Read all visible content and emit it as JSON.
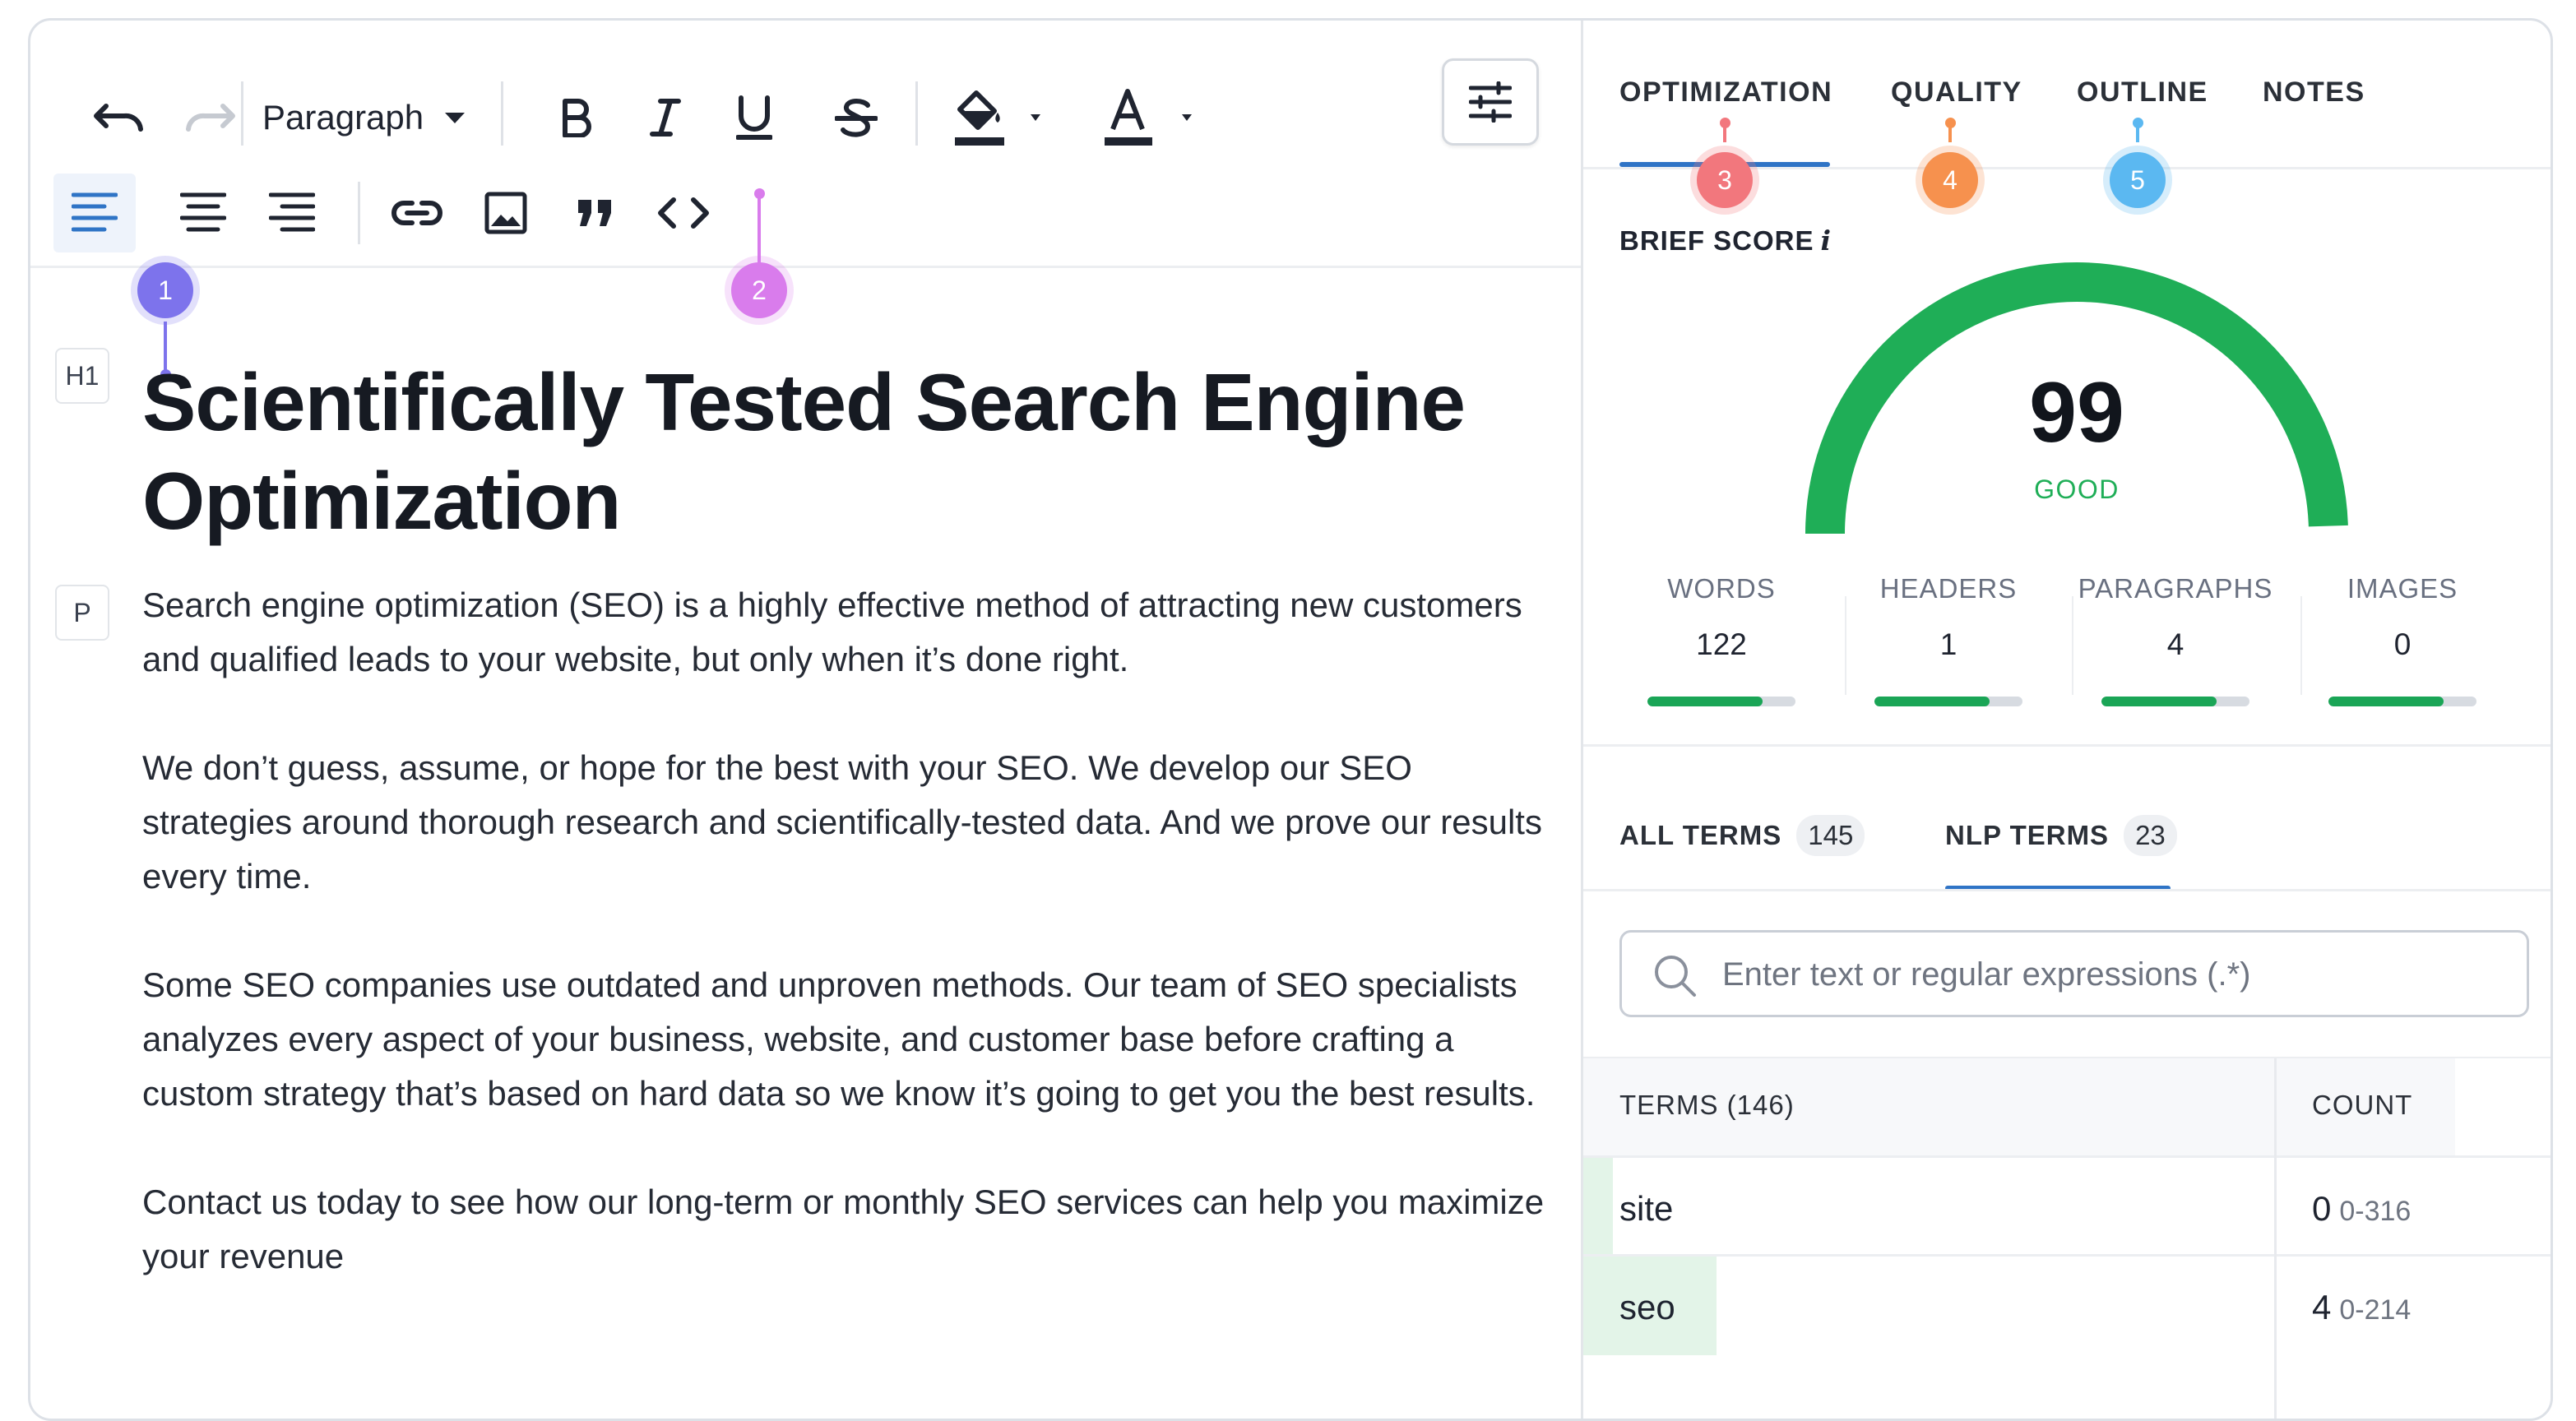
{
  "editor": {
    "toolbar": {
      "block_type": "Paragraph"
    },
    "markers": [
      "1",
      "2"
    ],
    "blocks": [
      {
        "tag": "H1",
        "text": "Scientifically Tested Search Engine Optimization"
      },
      {
        "tag": "P",
        "text": "Search engine optimization (SEO) is a highly effective method of attracting new customers and qualified leads to your website, but only when it’s done right."
      }
    ],
    "paragraphs": [
      "We don’t guess, assume, or hope for the best with your SEO. We develop our SEO strategies around thorough research and scientifically-tested data. And we prove our results every time.",
      "Some SEO companies use outdated and unproven methods. Our team of SEO specialists analyzes every aspect of your business, website, and customer base before crafting a custom strategy that’s based on hard data so we know it’s going to get you the best results.",
      "Contact us today to see how our long-term or monthly SEO services can help you maximize your revenue"
    ]
  },
  "panel": {
    "tabs": [
      {
        "label": "OPTIMIZATION",
        "marker": "3",
        "active": true
      },
      {
        "label": "QUALITY",
        "marker": "4"
      },
      {
        "label": "OUTLINE",
        "marker": "5"
      },
      {
        "label": "NOTES"
      }
    ],
    "brief_score": {
      "label": "BRIEF SCORE",
      "info": "i",
      "value": "99",
      "max": 100,
      "rating": "GOOD"
    },
    "stats": [
      {
        "label": "WORDS",
        "value": "122",
        "progress": 0.78
      },
      {
        "label": "HEADERS",
        "value": "1",
        "progress": 0.78
      },
      {
        "label": "PARAGRAPHS",
        "value": "4",
        "progress": 0.78
      },
      {
        "label": "IMAGES",
        "value": "0",
        "progress": 0.78
      }
    ],
    "term_tabs": [
      {
        "label": "ALL TERMS",
        "count": "145"
      },
      {
        "label": "NLP TERMS",
        "count": "23",
        "active": true
      }
    ],
    "search": {
      "placeholder": "Enter text or regular expressions (.*)",
      "value": ""
    },
    "table": {
      "headers": [
        "TERMS (146)",
        "COUNT"
      ],
      "rows": [
        {
          "term": "site",
          "count": "0",
          "range": "0-316",
          "coverage": 0.0
        },
        {
          "term": "seo",
          "count": "4",
          "range": "0-214",
          "coverage": 0.02
        }
      ]
    }
  },
  "colors": {
    "accent": "#2f74c6",
    "good": "#1fae57",
    "marker_1": "#7d73ec",
    "marker_2": "#d97cec",
    "marker_3": "#f2777d",
    "marker_4": "#f6914e",
    "marker_5": "#5bb8f1"
  },
  "icons": [
    "undo-icon",
    "redo-icon",
    "bold-icon",
    "italic-icon",
    "underline-icon",
    "strikethrough-icon",
    "fill-color-icon",
    "text-color-icon",
    "settings-sliders-icon",
    "align-left-icon",
    "align-center-icon",
    "align-right-icon",
    "link-icon",
    "image-icon",
    "quote-icon",
    "code-icon",
    "search-icon"
  ]
}
